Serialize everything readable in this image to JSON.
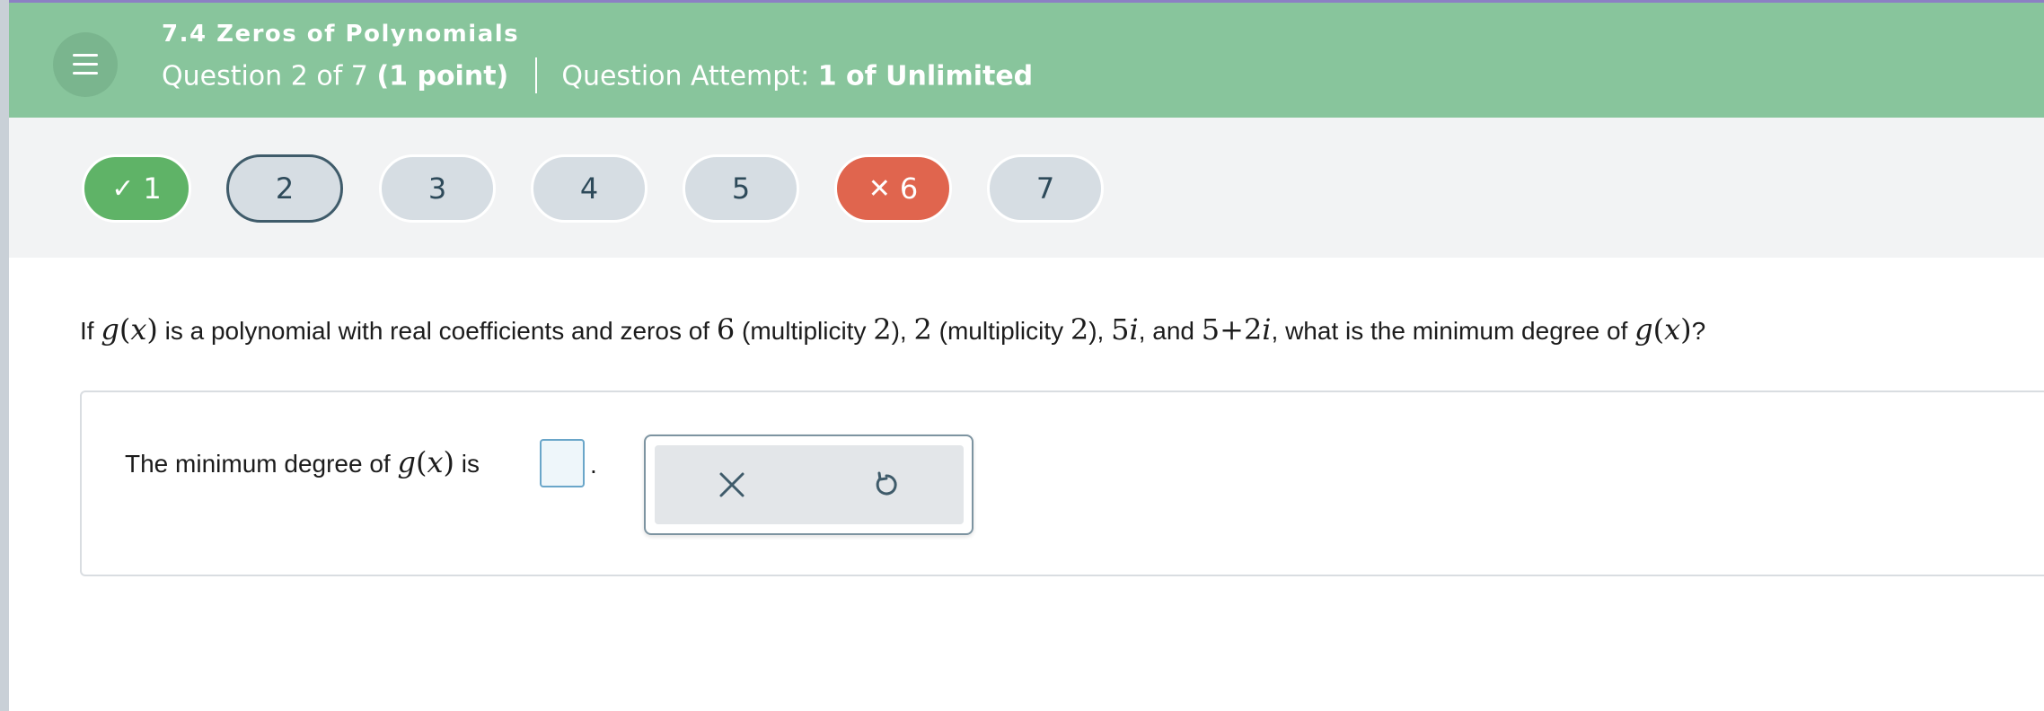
{
  "header": {
    "section_title": "7.4 Zeros of Polynomials",
    "question_counter": "Question 2 of 7",
    "points": "(1 point)",
    "attempt_label": "Question Attempt:",
    "attempt_value": "1 of Unlimited",
    "menu_icon": "hamburger-menu-icon"
  },
  "question_nav": {
    "items": [
      {
        "label": "1",
        "status": "correct",
        "mark": "✓"
      },
      {
        "label": "2",
        "status": "current"
      },
      {
        "label": "3",
        "status": "unanswered"
      },
      {
        "label": "4",
        "status": "unanswered"
      },
      {
        "label": "5",
        "status": "unanswered"
      },
      {
        "label": "6",
        "status": "incorrect",
        "mark": "✕"
      },
      {
        "label": "7",
        "status": "unanswered"
      }
    ],
    "colors": {
      "correct": "#5fb367",
      "incorrect": "#e0654e",
      "default": "#d6dde3",
      "current_border": "#3f5b6a"
    }
  },
  "question": {
    "t1": "If ",
    "g": "g",
    "lp": "(",
    "x": "x",
    "rp": ")",
    "t2": " is a polynomial with real coefficients and zeros of ",
    "z1": "6",
    "t3": " (multiplicity ",
    "m1": "2",
    "t4": "), ",
    "z2": "2",
    "t5": " (multiplicity ",
    "m2": "2",
    "t6": "), ",
    "z3_num": "5",
    "z3_i": "i",
    "t7": ", and ",
    "z4_pre": "5+2",
    "z4_i": "i",
    "t8": ", what is the minimum degree of ",
    "t9": "?"
  },
  "answer": {
    "prefix": "The minimum degree of ",
    "suffix": " is",
    "input_value": "",
    "period": "."
  },
  "toolbox": {
    "clear_icon": "close-icon",
    "reset_icon": "undo-icon"
  },
  "colors": {
    "header_bg": "#88c59c",
    "header_top_border": "#8c7fc4",
    "nav_band_bg": "#f2f3f4"
  }
}
